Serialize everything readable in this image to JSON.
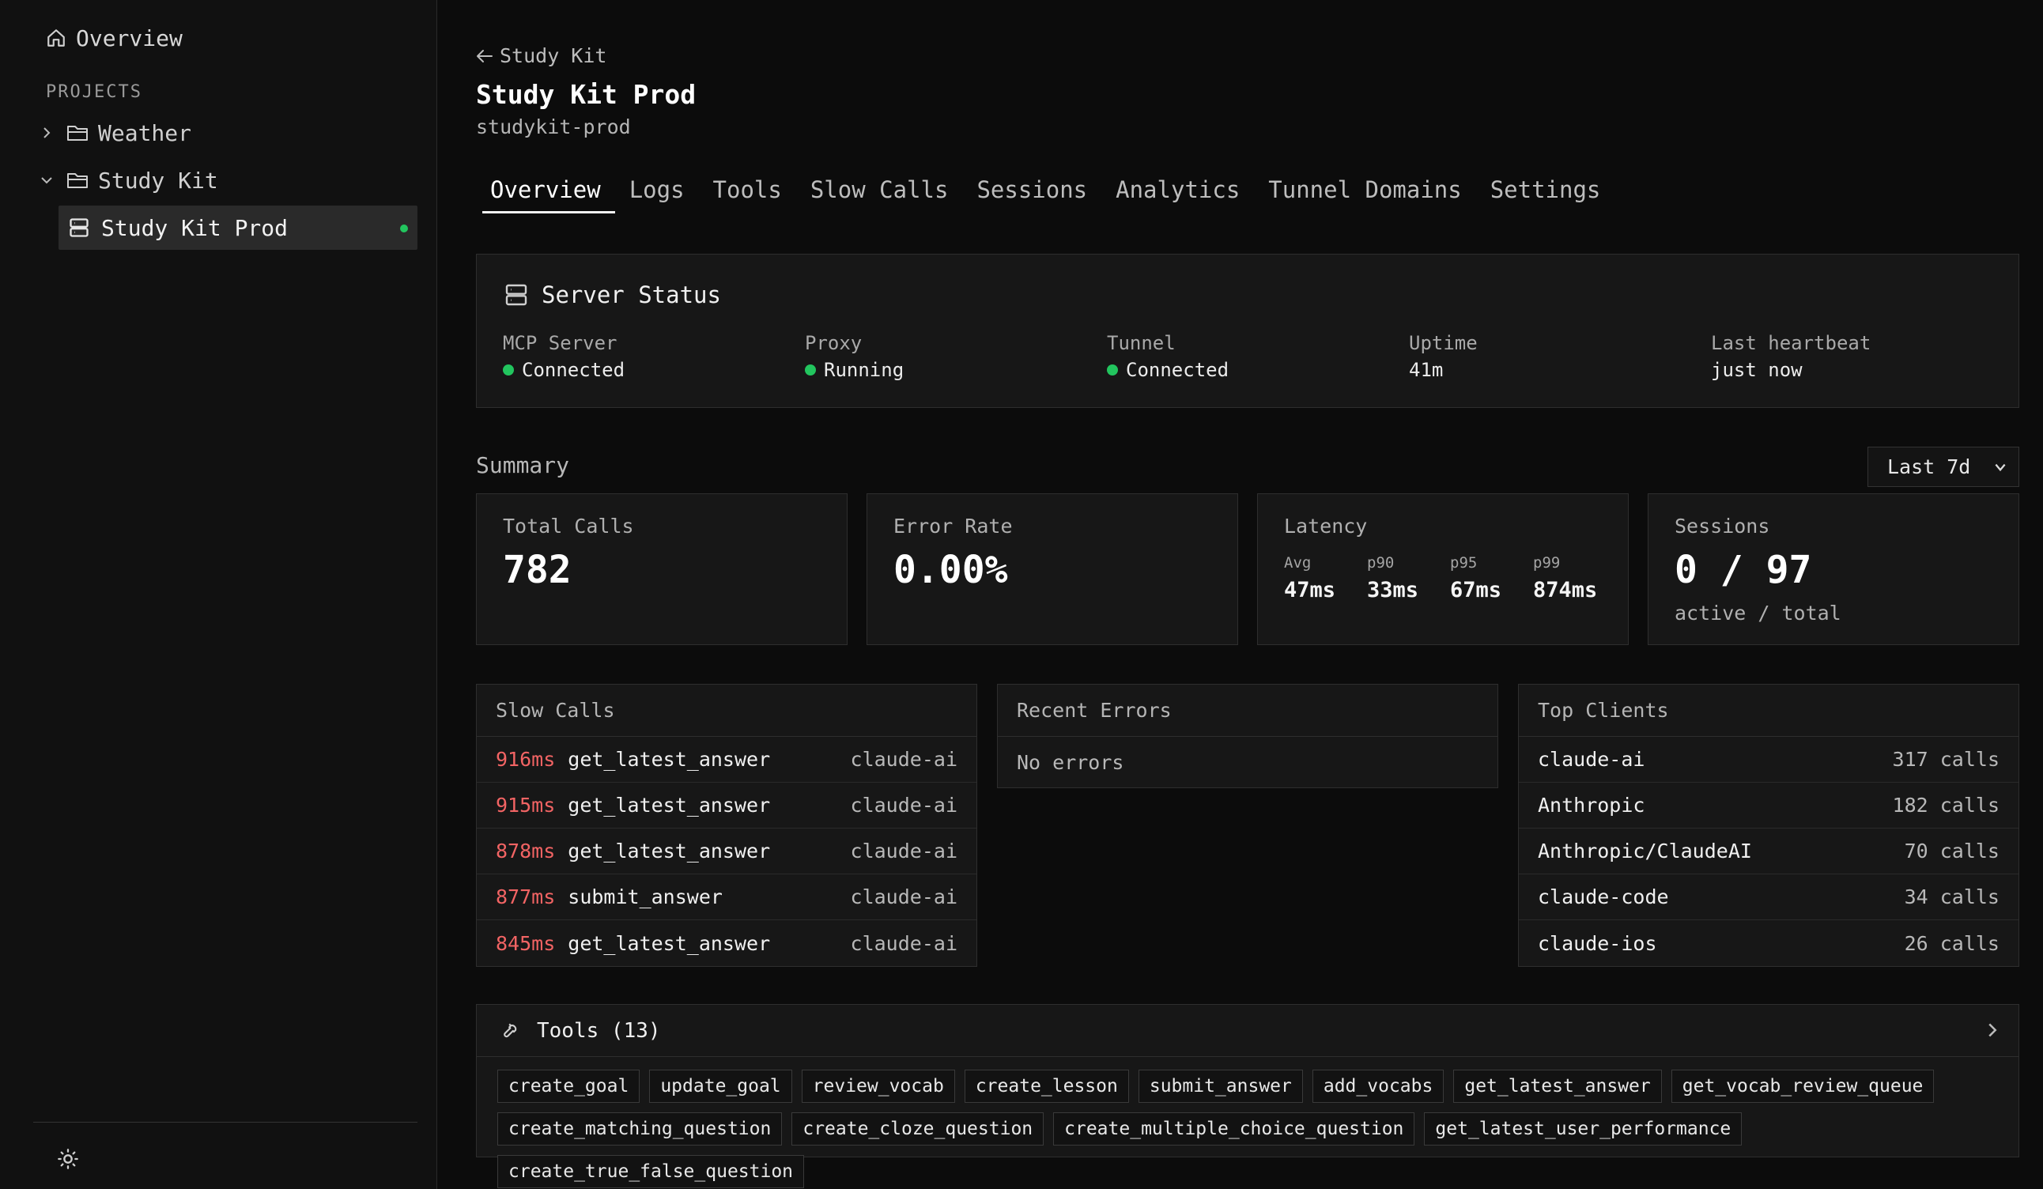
{
  "sidebar": {
    "overview_label": "Overview",
    "projects_heading": "PROJECTS",
    "folders": [
      {
        "label": "Weather",
        "expanded": false
      },
      {
        "label": "Study Kit",
        "expanded": true
      }
    ],
    "active_server": {
      "label": "Study Kit Prod",
      "status": "online"
    }
  },
  "header": {
    "back_label": "Study Kit",
    "title": "Study Kit Prod",
    "slug": "studykit-prod"
  },
  "tabs": [
    "Overview",
    "Logs",
    "Tools",
    "Slow Calls",
    "Sessions",
    "Analytics",
    "Tunnel Domains",
    "Settings"
  ],
  "active_tab": "Overview",
  "server_status": {
    "title": "Server Status",
    "items": [
      {
        "label": "MCP Server",
        "value": "Connected",
        "dot": true
      },
      {
        "label": "Proxy",
        "value": "Running",
        "dot": true
      },
      {
        "label": "Tunnel",
        "value": "Connected",
        "dot": true
      },
      {
        "label": "Uptime",
        "value": "41m",
        "dot": false
      },
      {
        "label": "Last heartbeat",
        "value": "just now",
        "dot": false
      }
    ]
  },
  "summary": {
    "label": "Summary",
    "range": "Last 7d",
    "total_calls": {
      "label": "Total Calls",
      "value": "782"
    },
    "error_rate": {
      "label": "Error Rate",
      "value": "0.00%"
    },
    "latency": {
      "label": "Latency",
      "cells": [
        {
          "k": "Avg",
          "v": "47ms"
        },
        {
          "k": "p90",
          "v": "33ms"
        },
        {
          "k": "p95",
          "v": "67ms"
        },
        {
          "k": "p99",
          "v": "874ms"
        }
      ]
    },
    "sessions": {
      "label": "Sessions",
      "value": "0 / 97",
      "sub": "active / total"
    }
  },
  "slow_calls": {
    "title": "Slow Calls",
    "rows": [
      {
        "ms": "916ms",
        "name": "get_latest_answer",
        "client": "claude-ai"
      },
      {
        "ms": "915ms",
        "name": "get_latest_answer",
        "client": "claude-ai"
      },
      {
        "ms": "878ms",
        "name": "get_latest_answer",
        "client": "claude-ai"
      },
      {
        "ms": "877ms",
        "name": "submit_answer",
        "client": "claude-ai"
      },
      {
        "ms": "845ms",
        "name": "get_latest_answer",
        "client": "claude-ai"
      }
    ]
  },
  "recent_errors": {
    "title": "Recent Errors",
    "empty": "No errors"
  },
  "top_clients": {
    "title": "Top Clients",
    "rows": [
      {
        "name": "claude-ai",
        "calls": "317 calls"
      },
      {
        "name": "Anthropic",
        "calls": "182 calls"
      },
      {
        "name": "Anthropic/ClaudeAI",
        "calls": "70 calls"
      },
      {
        "name": "claude-code",
        "calls": "34 calls"
      },
      {
        "name": "claude-ios",
        "calls": "26 calls"
      }
    ]
  },
  "tools": {
    "title": "Tools (13)",
    "items": [
      "create_goal",
      "update_goal",
      "review_vocab",
      "create_lesson",
      "submit_answer",
      "add_vocabs",
      "get_latest_answer",
      "get_vocab_review_queue",
      "create_matching_question",
      "create_cloze_question",
      "create_multiple_choice_question",
      "get_latest_user_performance",
      "create_true_false_question"
    ]
  },
  "colors": {
    "accent_green": "#22c55e",
    "slow_red": "#f26464"
  }
}
